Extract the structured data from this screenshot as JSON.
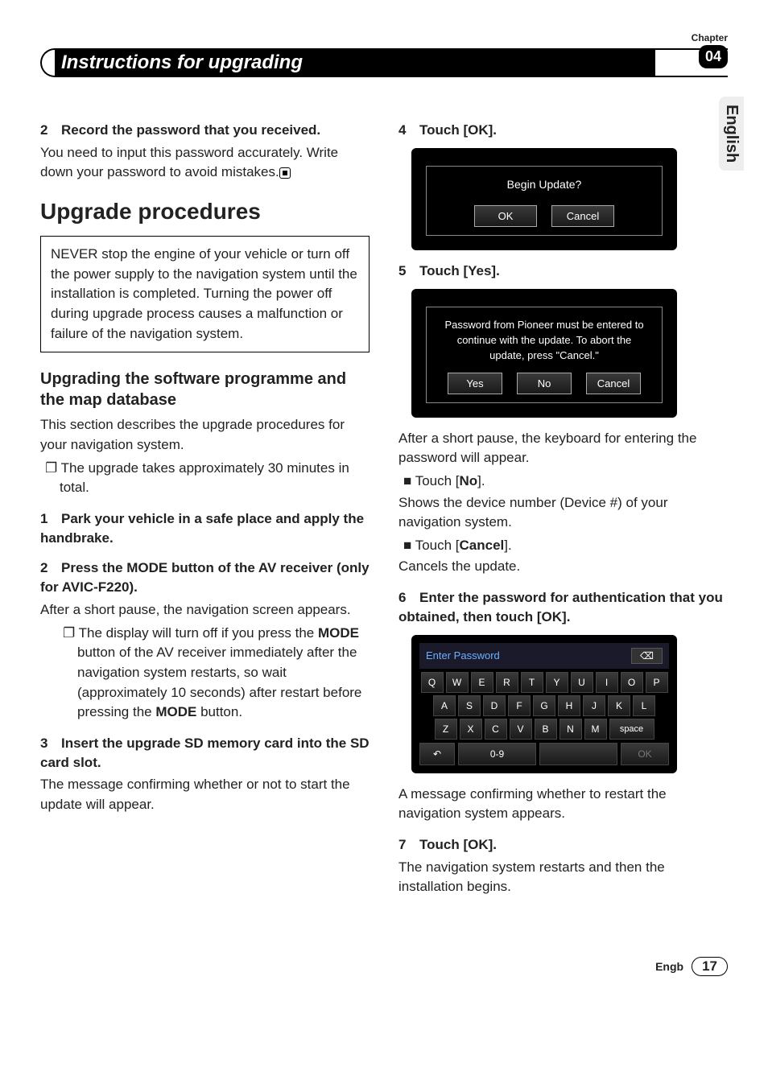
{
  "chapter": {
    "label": "Chapter",
    "number": "04"
  },
  "title": "Instructions for upgrading",
  "lang_tab": "English",
  "left": {
    "step2": {
      "num": "2",
      "head": "Record the password that you received."
    },
    "step2_body": "You need to input this password accurately. Write down your password to avoid mistakes.",
    "h_procedures": "Upgrade procedures",
    "warning": "NEVER stop the engine of your vehicle or turn off the power supply to the navigation system until the installation is completed. Turning the power off during upgrade process causes a malfunction or failure of the navigation system.",
    "h_upgrading": "Upgrading the software programme and the map database",
    "p_intro": "This section describes the upgrade procedures for your navigation system.",
    "b_time": "The upgrade takes approximately 30 minutes in total.",
    "s1": {
      "num": "1",
      "head": "Park your vehicle in a safe place and apply the handbrake."
    },
    "s2": {
      "num": "2",
      "head": "Press the MODE button of the AV receiver (only for AVIC-F220)."
    },
    "s2_body": "After a short pause, the navigation screen appears.",
    "s2_note_a": "The display will turn off if you press the ",
    "s2_note_b": " button of the AV receiver immediately after the navigation system restarts, so wait (approximately 10 seconds) after restart before pressing the ",
    "s2_note_c": " button.",
    "mode": "MODE",
    "s3": {
      "num": "3",
      "head": "Insert the upgrade SD memory card into the SD card slot."
    },
    "s3_body": "The message confirming whether or not to start the update will appear."
  },
  "right": {
    "s4": {
      "num": "4",
      "head": "Touch [OK]."
    },
    "shot1": {
      "msg": "Begin Update?",
      "ok": "OK",
      "cancel": "Cancel"
    },
    "s5": {
      "num": "5",
      "head": "Touch [Yes]."
    },
    "shot2": {
      "l1": "Password from Pioneer must be entered to",
      "l2": "continue with the update.  To abort the",
      "l3": "update, press \"Cancel.\"",
      "yes": "Yes",
      "no": "No",
      "cancel": "Cancel"
    },
    "p_after": "After a short pause, the keyboard for entering the password will appear.",
    "b_no_pre": "Touch [",
    "b_no_bold": "No",
    "b_no_post": "].",
    "p_no": "Shows the device number (Device #) of your navigation system.",
    "b_cancel_pre": "Touch [",
    "b_cancel_bold": "Cancel",
    "b_cancel_post": "].",
    "p_cancel": "Cancels the update.",
    "s6": {
      "num": "6",
      "head": "Enter the password for authentication that you obtained, then touch [OK]."
    },
    "kb": {
      "title": "Enter Password",
      "back_icon": "back-arrow-icon",
      "r1": [
        "Q",
        "W",
        "E",
        "R",
        "T",
        "Y",
        "U",
        "I",
        "O",
        "P"
      ],
      "r2": [
        "A",
        "S",
        "D",
        "F",
        "G",
        "H",
        "J",
        "K",
        "L"
      ],
      "r3": [
        "Z",
        "X",
        "C",
        "V",
        "B",
        "N",
        "M"
      ],
      "space": "space",
      "undo": "↶",
      "num_mode": "0-9",
      "ok": "OK"
    },
    "p_after_kb": "A message confirming whether to restart the navigation system appears.",
    "s7": {
      "num": "7",
      "head": "Touch [OK]."
    },
    "s7_body": "The navigation system restarts and then the installation begins."
  },
  "footer": {
    "lang": "Engb",
    "page": "17"
  }
}
